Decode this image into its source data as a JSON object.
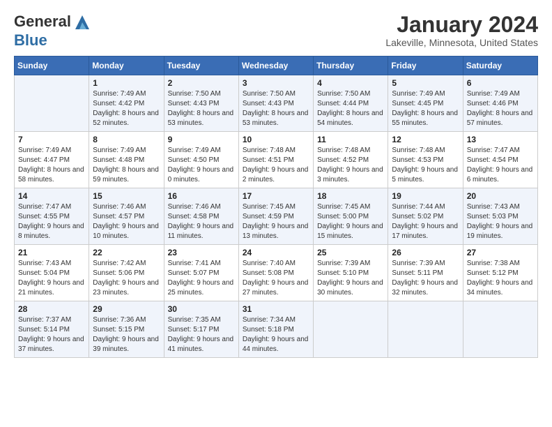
{
  "header": {
    "logo_general": "General",
    "logo_blue": "Blue",
    "month_title": "January 2024",
    "location": "Lakeville, Minnesota, United States"
  },
  "days_of_week": [
    "Sunday",
    "Monday",
    "Tuesday",
    "Wednesday",
    "Thursday",
    "Friday",
    "Saturday"
  ],
  "weeks": [
    [
      {
        "day": "",
        "sunrise": "",
        "sunset": "",
        "daylight": ""
      },
      {
        "day": "1",
        "sunrise": "Sunrise: 7:49 AM",
        "sunset": "Sunset: 4:42 PM",
        "daylight": "Daylight: 8 hours and 52 minutes."
      },
      {
        "day": "2",
        "sunrise": "Sunrise: 7:50 AM",
        "sunset": "Sunset: 4:43 PM",
        "daylight": "Daylight: 8 hours and 53 minutes."
      },
      {
        "day": "3",
        "sunrise": "Sunrise: 7:50 AM",
        "sunset": "Sunset: 4:43 PM",
        "daylight": "Daylight: 8 hours and 53 minutes."
      },
      {
        "day": "4",
        "sunrise": "Sunrise: 7:50 AM",
        "sunset": "Sunset: 4:44 PM",
        "daylight": "Daylight: 8 hours and 54 minutes."
      },
      {
        "day": "5",
        "sunrise": "Sunrise: 7:49 AM",
        "sunset": "Sunset: 4:45 PM",
        "daylight": "Daylight: 8 hours and 55 minutes."
      },
      {
        "day": "6",
        "sunrise": "Sunrise: 7:49 AM",
        "sunset": "Sunset: 4:46 PM",
        "daylight": "Daylight: 8 hours and 57 minutes."
      }
    ],
    [
      {
        "day": "7",
        "sunrise": "Sunrise: 7:49 AM",
        "sunset": "Sunset: 4:47 PM",
        "daylight": "Daylight: 8 hours and 58 minutes."
      },
      {
        "day": "8",
        "sunrise": "Sunrise: 7:49 AM",
        "sunset": "Sunset: 4:48 PM",
        "daylight": "Daylight: 8 hours and 59 minutes."
      },
      {
        "day": "9",
        "sunrise": "Sunrise: 7:49 AM",
        "sunset": "Sunset: 4:50 PM",
        "daylight": "Daylight: 9 hours and 0 minutes."
      },
      {
        "day": "10",
        "sunrise": "Sunrise: 7:48 AM",
        "sunset": "Sunset: 4:51 PM",
        "daylight": "Daylight: 9 hours and 2 minutes."
      },
      {
        "day": "11",
        "sunrise": "Sunrise: 7:48 AM",
        "sunset": "Sunset: 4:52 PM",
        "daylight": "Daylight: 9 hours and 3 minutes."
      },
      {
        "day": "12",
        "sunrise": "Sunrise: 7:48 AM",
        "sunset": "Sunset: 4:53 PM",
        "daylight": "Daylight: 9 hours and 5 minutes."
      },
      {
        "day": "13",
        "sunrise": "Sunrise: 7:47 AM",
        "sunset": "Sunset: 4:54 PM",
        "daylight": "Daylight: 9 hours and 6 minutes."
      }
    ],
    [
      {
        "day": "14",
        "sunrise": "Sunrise: 7:47 AM",
        "sunset": "Sunset: 4:55 PM",
        "daylight": "Daylight: 9 hours and 8 minutes."
      },
      {
        "day": "15",
        "sunrise": "Sunrise: 7:46 AM",
        "sunset": "Sunset: 4:57 PM",
        "daylight": "Daylight: 9 hours and 10 minutes."
      },
      {
        "day": "16",
        "sunrise": "Sunrise: 7:46 AM",
        "sunset": "Sunset: 4:58 PM",
        "daylight": "Daylight: 9 hours and 11 minutes."
      },
      {
        "day": "17",
        "sunrise": "Sunrise: 7:45 AM",
        "sunset": "Sunset: 4:59 PM",
        "daylight": "Daylight: 9 hours and 13 minutes."
      },
      {
        "day": "18",
        "sunrise": "Sunrise: 7:45 AM",
        "sunset": "Sunset: 5:00 PM",
        "daylight": "Daylight: 9 hours and 15 minutes."
      },
      {
        "day": "19",
        "sunrise": "Sunrise: 7:44 AM",
        "sunset": "Sunset: 5:02 PM",
        "daylight": "Daylight: 9 hours and 17 minutes."
      },
      {
        "day": "20",
        "sunrise": "Sunrise: 7:43 AM",
        "sunset": "Sunset: 5:03 PM",
        "daylight": "Daylight: 9 hours and 19 minutes."
      }
    ],
    [
      {
        "day": "21",
        "sunrise": "Sunrise: 7:43 AM",
        "sunset": "Sunset: 5:04 PM",
        "daylight": "Daylight: 9 hours and 21 minutes."
      },
      {
        "day": "22",
        "sunrise": "Sunrise: 7:42 AM",
        "sunset": "Sunset: 5:06 PM",
        "daylight": "Daylight: 9 hours and 23 minutes."
      },
      {
        "day": "23",
        "sunrise": "Sunrise: 7:41 AM",
        "sunset": "Sunset: 5:07 PM",
        "daylight": "Daylight: 9 hours and 25 minutes."
      },
      {
        "day": "24",
        "sunrise": "Sunrise: 7:40 AM",
        "sunset": "Sunset: 5:08 PM",
        "daylight": "Daylight: 9 hours and 27 minutes."
      },
      {
        "day": "25",
        "sunrise": "Sunrise: 7:39 AM",
        "sunset": "Sunset: 5:10 PM",
        "daylight": "Daylight: 9 hours and 30 minutes."
      },
      {
        "day": "26",
        "sunrise": "Sunrise: 7:39 AM",
        "sunset": "Sunset: 5:11 PM",
        "daylight": "Daylight: 9 hours and 32 minutes."
      },
      {
        "day": "27",
        "sunrise": "Sunrise: 7:38 AM",
        "sunset": "Sunset: 5:12 PM",
        "daylight": "Daylight: 9 hours and 34 minutes."
      }
    ],
    [
      {
        "day": "28",
        "sunrise": "Sunrise: 7:37 AM",
        "sunset": "Sunset: 5:14 PM",
        "daylight": "Daylight: 9 hours and 37 minutes."
      },
      {
        "day": "29",
        "sunrise": "Sunrise: 7:36 AM",
        "sunset": "Sunset: 5:15 PM",
        "daylight": "Daylight: 9 hours and 39 minutes."
      },
      {
        "day": "30",
        "sunrise": "Sunrise: 7:35 AM",
        "sunset": "Sunset: 5:17 PM",
        "daylight": "Daylight: 9 hours and 41 minutes."
      },
      {
        "day": "31",
        "sunrise": "Sunrise: 7:34 AM",
        "sunset": "Sunset: 5:18 PM",
        "daylight": "Daylight: 9 hours and 44 minutes."
      },
      {
        "day": "",
        "sunrise": "",
        "sunset": "",
        "daylight": ""
      },
      {
        "day": "",
        "sunrise": "",
        "sunset": "",
        "daylight": ""
      },
      {
        "day": "",
        "sunrise": "",
        "sunset": "",
        "daylight": ""
      }
    ]
  ]
}
